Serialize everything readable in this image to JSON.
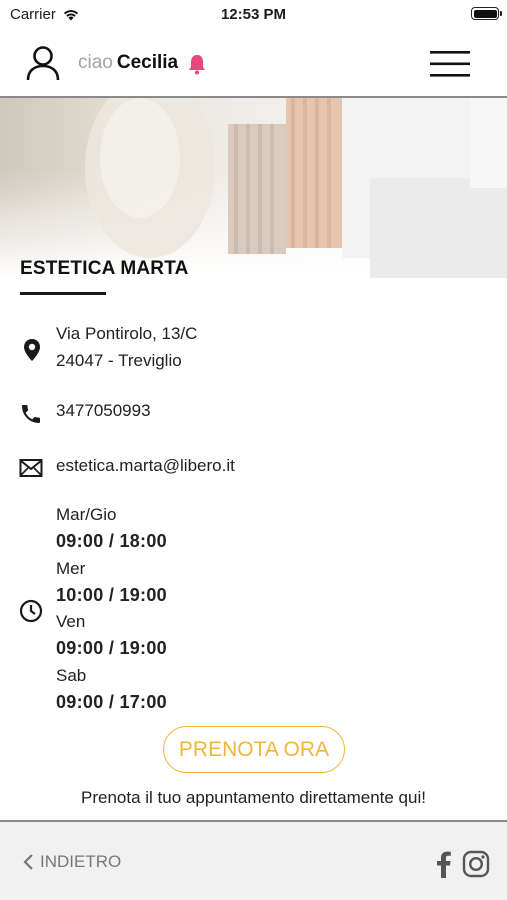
{
  "status_bar": {
    "carrier": "Carrier",
    "time": "12:53 PM"
  },
  "header": {
    "greeting": "ciao",
    "user_name": "Cecilia",
    "icons": [
      "user-icon",
      "bell-icon",
      "hamburger-menu-icon"
    ],
    "bell_color": "#e8477a"
  },
  "salon": {
    "name": "ESTETICA MARTA",
    "address_line1": "Via Pontirolo, 13/C",
    "address_line2": "24047 - Treviglio",
    "phone": "3477050993",
    "email": "estetica.marta@libero.it",
    "hours": [
      {
        "days": "Mar/Gio",
        "time": "09:00 / 18:00"
      },
      {
        "days": "Mer",
        "time": "10:00 / 19:00"
      },
      {
        "days": "Ven",
        "time": "09:00 / 19:00"
      },
      {
        "days": "Sab",
        "time": "09:00 / 17:00"
      }
    ]
  },
  "cta": {
    "label": "PRENOTA ORA",
    "note": "Prenota il tuo appuntamento direttamente qui!",
    "accent": "#f0b63a"
  },
  "footer": {
    "back_label": "INDIETRO",
    "social_icons": [
      "facebook-icon",
      "instagram-icon"
    ]
  }
}
